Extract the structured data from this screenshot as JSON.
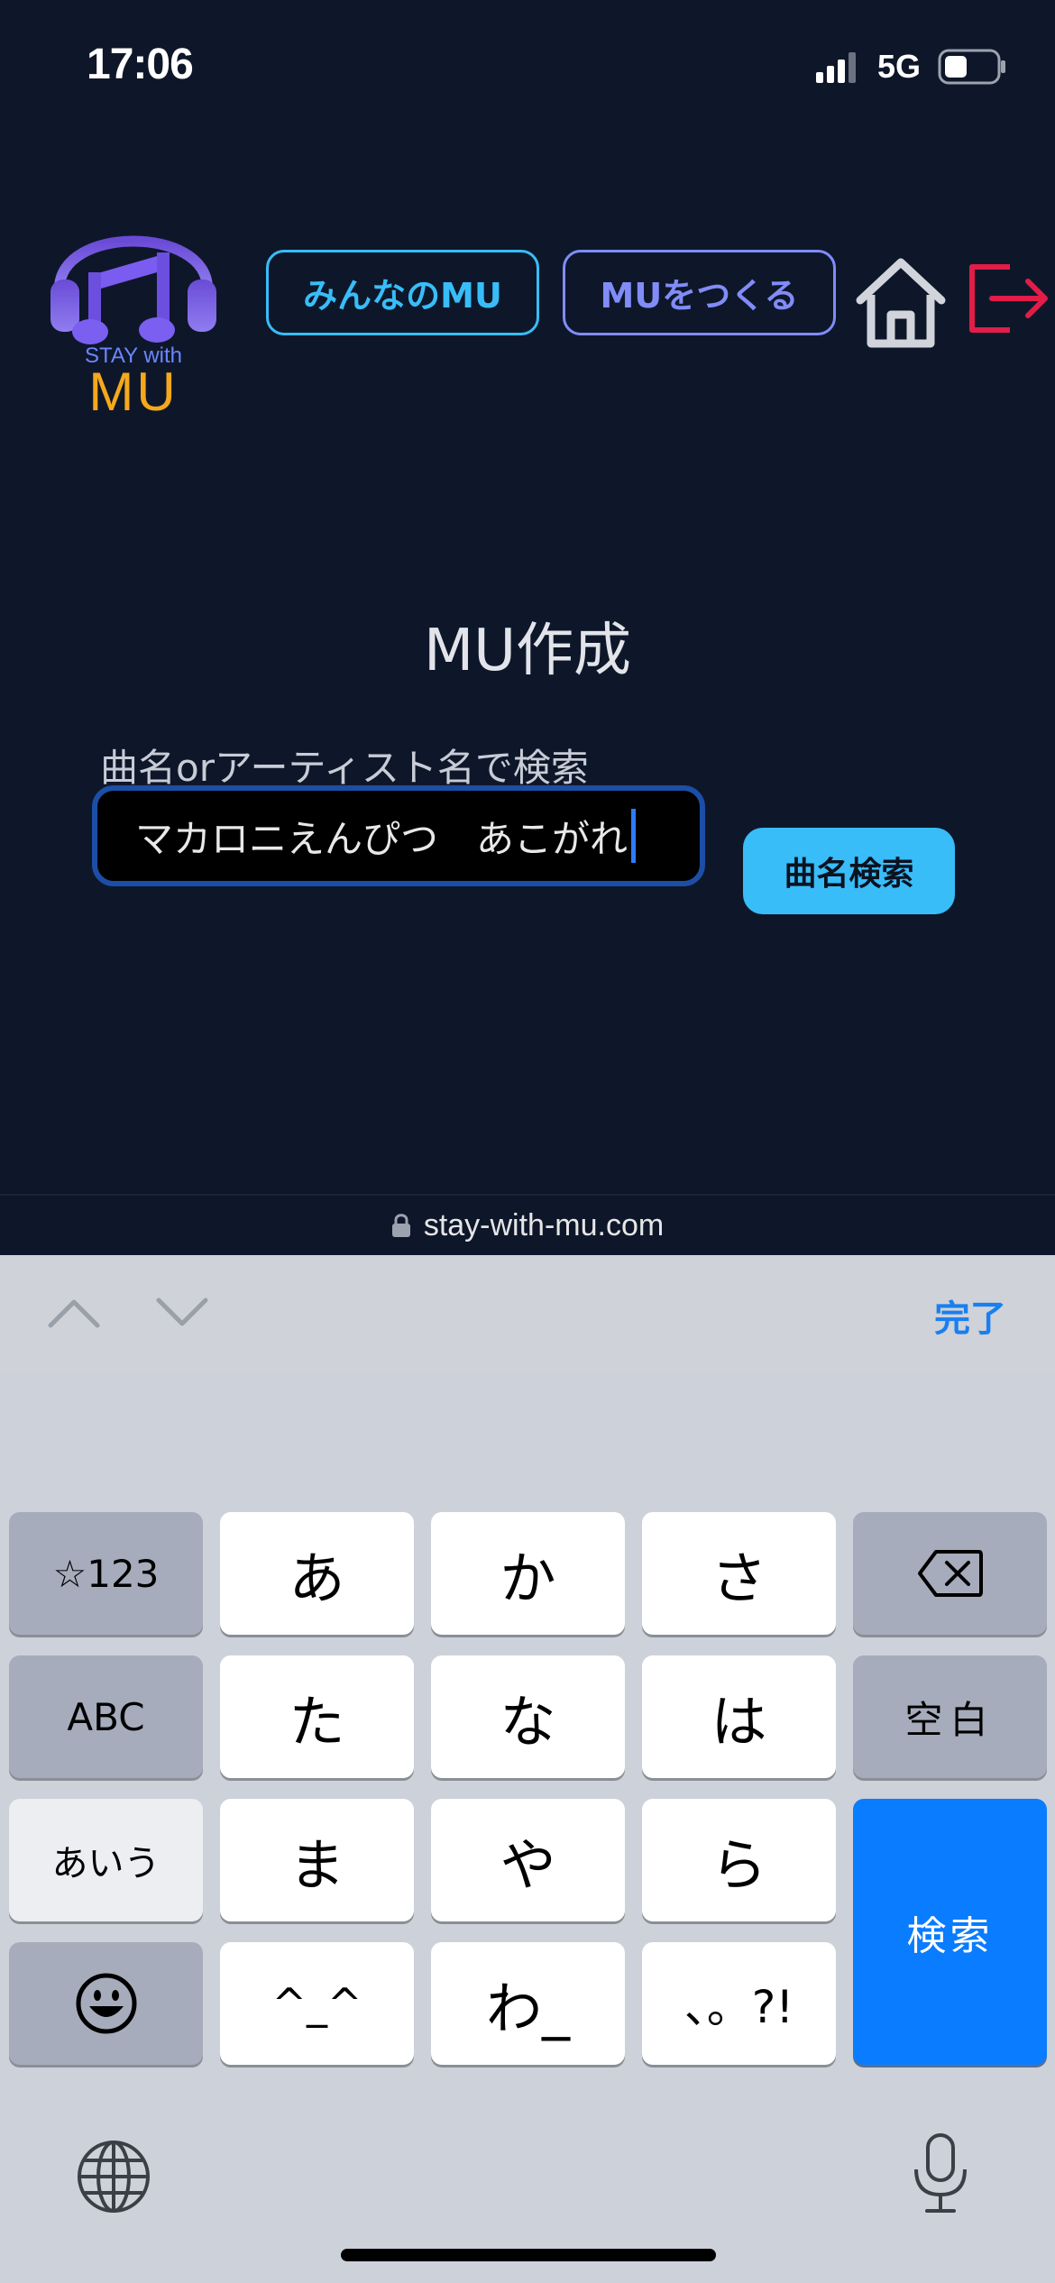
{
  "status_bar": {
    "time": "17:06",
    "network": "5G"
  },
  "header": {
    "logo_tagline": "STAY with",
    "logo_word": "MU",
    "nav_everyone_label": "みんなのMU",
    "nav_create_label": "MUをつくる"
  },
  "main": {
    "title": "MU作成",
    "search_label": "曲名orアーティスト名で検索",
    "search_value": "マカロニえんぴつ　あこがれ",
    "search_button_label": "曲名検索"
  },
  "browser": {
    "url": "stay-with-mu.com"
  },
  "accessory_bar": {
    "done_label": "完了"
  },
  "keyboard": {
    "row1": [
      "☆123",
      "あ",
      "か",
      "さ"
    ],
    "row2": [
      "ABC",
      "た",
      "な",
      "は",
      "空白"
    ],
    "row3": [
      "あいう",
      "ま",
      "や",
      "ら"
    ],
    "row4": [
      "^_^",
      "わ_",
      "、。?!"
    ],
    "search_key_label": "検索"
  },
  "colors": {
    "background": "#0e172a",
    "accent_cyan": "#38bdf8",
    "accent_indigo": "#818cf8",
    "logout_red": "#e11d48",
    "keyboard_blue": "#0a7cff"
  }
}
